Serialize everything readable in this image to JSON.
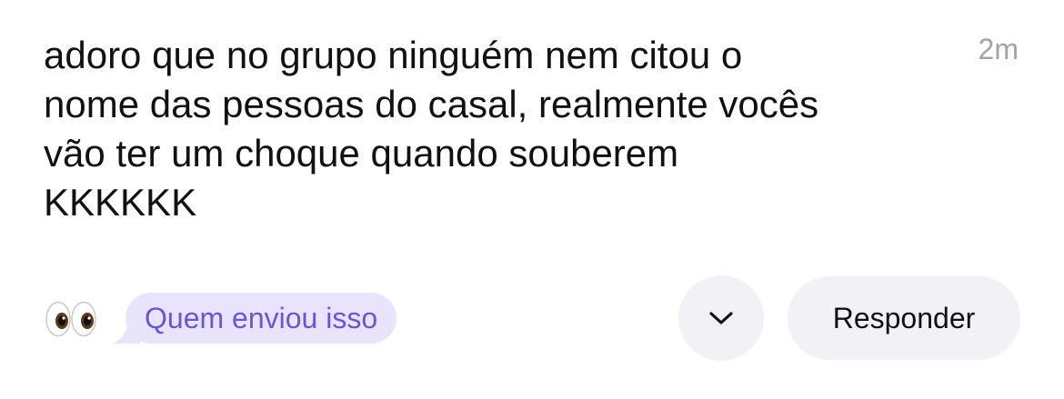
{
  "message": {
    "text": "adoro que no grupo ninguém nem citou o\nnome das pessoas do casal, realmente vocês\nvão ter um choque quando souberem\nKKKKKK",
    "timestamp": "2m"
  },
  "footer": {
    "reaction_icon": "eyes-emoji",
    "prompt_label": "Quem enviou isso",
    "more_icon": "chevron-down-icon",
    "reply_label": "Responder"
  },
  "colors": {
    "bubble_bg": "#e9e4fb",
    "bubble_text": "#6d55d9",
    "button_bg": "#f2f2f6",
    "timestamp": "#a3a3a8"
  }
}
